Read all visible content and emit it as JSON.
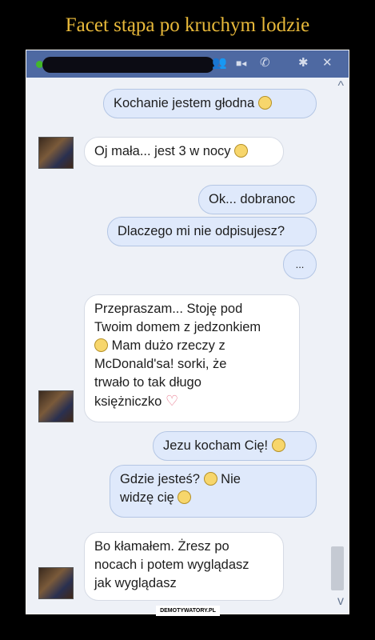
{
  "title": "Facet stąpa po kruchym lodzie",
  "toolbar": {
    "add_icon": "person-plus-icon",
    "video_icon": "video-camera-icon",
    "phone_icon": "phone-icon",
    "settings_icon": "gear-icon",
    "close_icon": "close-icon",
    "glyphs": {
      "add": "👥",
      "video": "■◂",
      "phone": "✆",
      "gear": "✱",
      "close": "✕"
    }
  },
  "messages": [
    {
      "side": "right",
      "text": "Kochanie jestem głodna",
      "emoji": "sad-face-icon"
    },
    {
      "side": "left",
      "text": "Oj mała... jest 3 w nocy",
      "emoji": "sad-face-icon"
    },
    {
      "side": "right",
      "text": "Ok... dobranoc"
    },
    {
      "side": "right",
      "text": "Dlaczego mi nie odpisujesz?"
    },
    {
      "side": "right",
      "text": "..."
    },
    {
      "side": "left",
      "lines": [
        "Przepraszam... Stoję pod",
        "Twoim domem z jedzonkiem",
        "Mam dużo rzeczy z",
        "McDonald'sa! sorki, że",
        "trwało to tak długo",
        "księżniczko"
      ],
      "emoji": "tongue-face-icon",
      "emoji_end": "heart-icon"
    },
    {
      "side": "right",
      "text": "Jezu kocham Cię!",
      "emoji": "wink-face-icon"
    },
    {
      "side": "right",
      "lines": [
        "Gdzie jesteś?",
        "Nie",
        "widzę cię"
      ],
      "emoji": "confused-face-icon",
      "emoji_end": "tongue-face-icon"
    },
    {
      "side": "left",
      "lines": [
        "Bo kłamałem. Żresz po",
        "nocach i potem wyglądasz",
        "jak wyglądasz"
      ]
    }
  ],
  "watermark": "DEMOTYWATORY.PL",
  "scroll": {
    "up": "^",
    "down": "v"
  }
}
